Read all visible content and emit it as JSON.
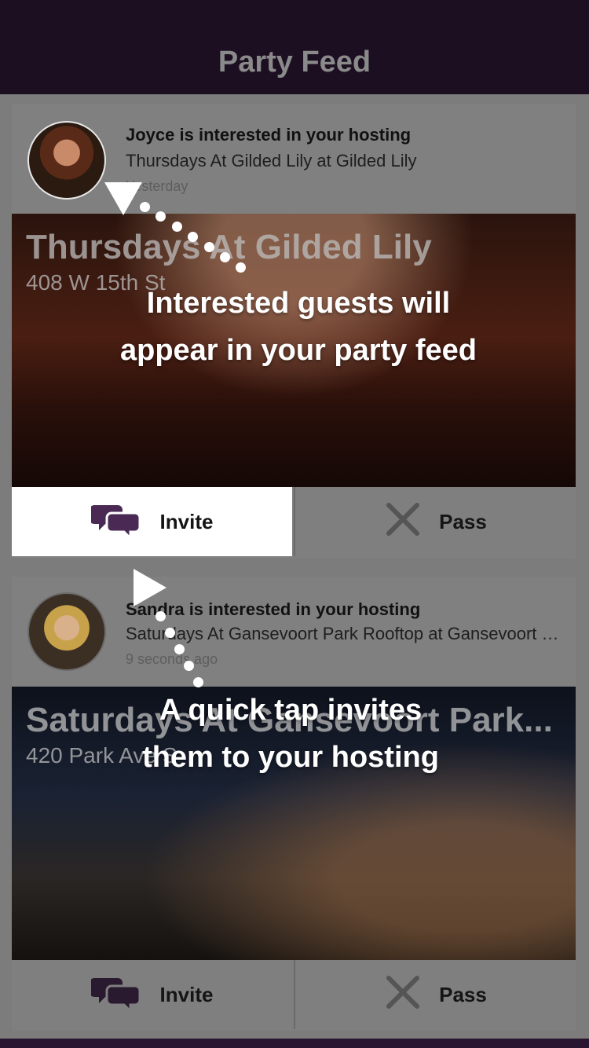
{
  "header": {
    "title": "Party Feed"
  },
  "cards": [
    {
      "headline": "Joyce is interested in your hosting",
      "subline": "Thursdays At Gilded Lily at Gilded Lily",
      "time": "Yesterday",
      "venue_title": "Thursdays At Gilded Lily",
      "venue_address": "408 W 15th St",
      "invite_label": "Invite",
      "pass_label": "Pass"
    },
    {
      "headline": "Sandra is interested in your hosting",
      "subline": "Saturdays At Gansevoort Park Rooftop at Gansevoort Park Rooftop",
      "time": "9 seconds ago",
      "venue_title": "Saturdays At Gansevoort Park...",
      "venue_address": "420 Park Ave S",
      "invite_label": "Invite",
      "pass_label": "Pass"
    }
  ],
  "tutorial": {
    "line1": "Interested guests will",
    "line2": "appear in your party feed",
    "line3": "A quick tap invites",
    "line4": "them to your hosting"
  },
  "icons": {
    "invite": "speech-bubbles-icon",
    "pass": "x-icon"
  },
  "colors": {
    "header_bg": "#1c0f22",
    "accent": "#4a2a55",
    "overlay_text": "#ffffff"
  }
}
